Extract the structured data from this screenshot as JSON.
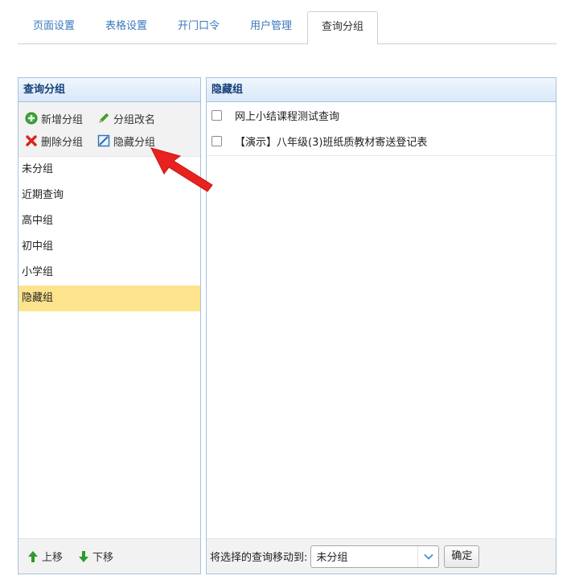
{
  "tabs": [
    {
      "label": "页面设置"
    },
    {
      "label": "表格设置"
    },
    {
      "label": "开门口令"
    },
    {
      "label": "用户管理"
    },
    {
      "label": "查询分组"
    }
  ],
  "active_tab": "查询分组",
  "left_panel": {
    "title": "查询分组",
    "toolbar": {
      "add": "新增分组",
      "rename": "分组改名",
      "delete": "删除分组",
      "hide": "隐藏分组"
    },
    "groups": [
      "未分组",
      "近期查询",
      "高中组",
      "初中组",
      "小学组",
      "隐藏组"
    ],
    "selected_group": "隐藏组",
    "footer": {
      "up": "上移",
      "down": "下移"
    }
  },
  "right_panel": {
    "title": "隐藏组",
    "queries": [
      "网上小结课程测试查询",
      "【演示】八年级(3)班纸质教材寄送登记表"
    ],
    "footer": {
      "move_label": "将选择的查询移动到:",
      "target_value": "未分组",
      "confirm": "确定"
    }
  },
  "colors": {
    "link": "#3a79bd",
    "header_text": "#14407a",
    "panel_border": "#a5c3e3",
    "selected_bg": "#fde48c",
    "annotation": "#e8231f"
  }
}
